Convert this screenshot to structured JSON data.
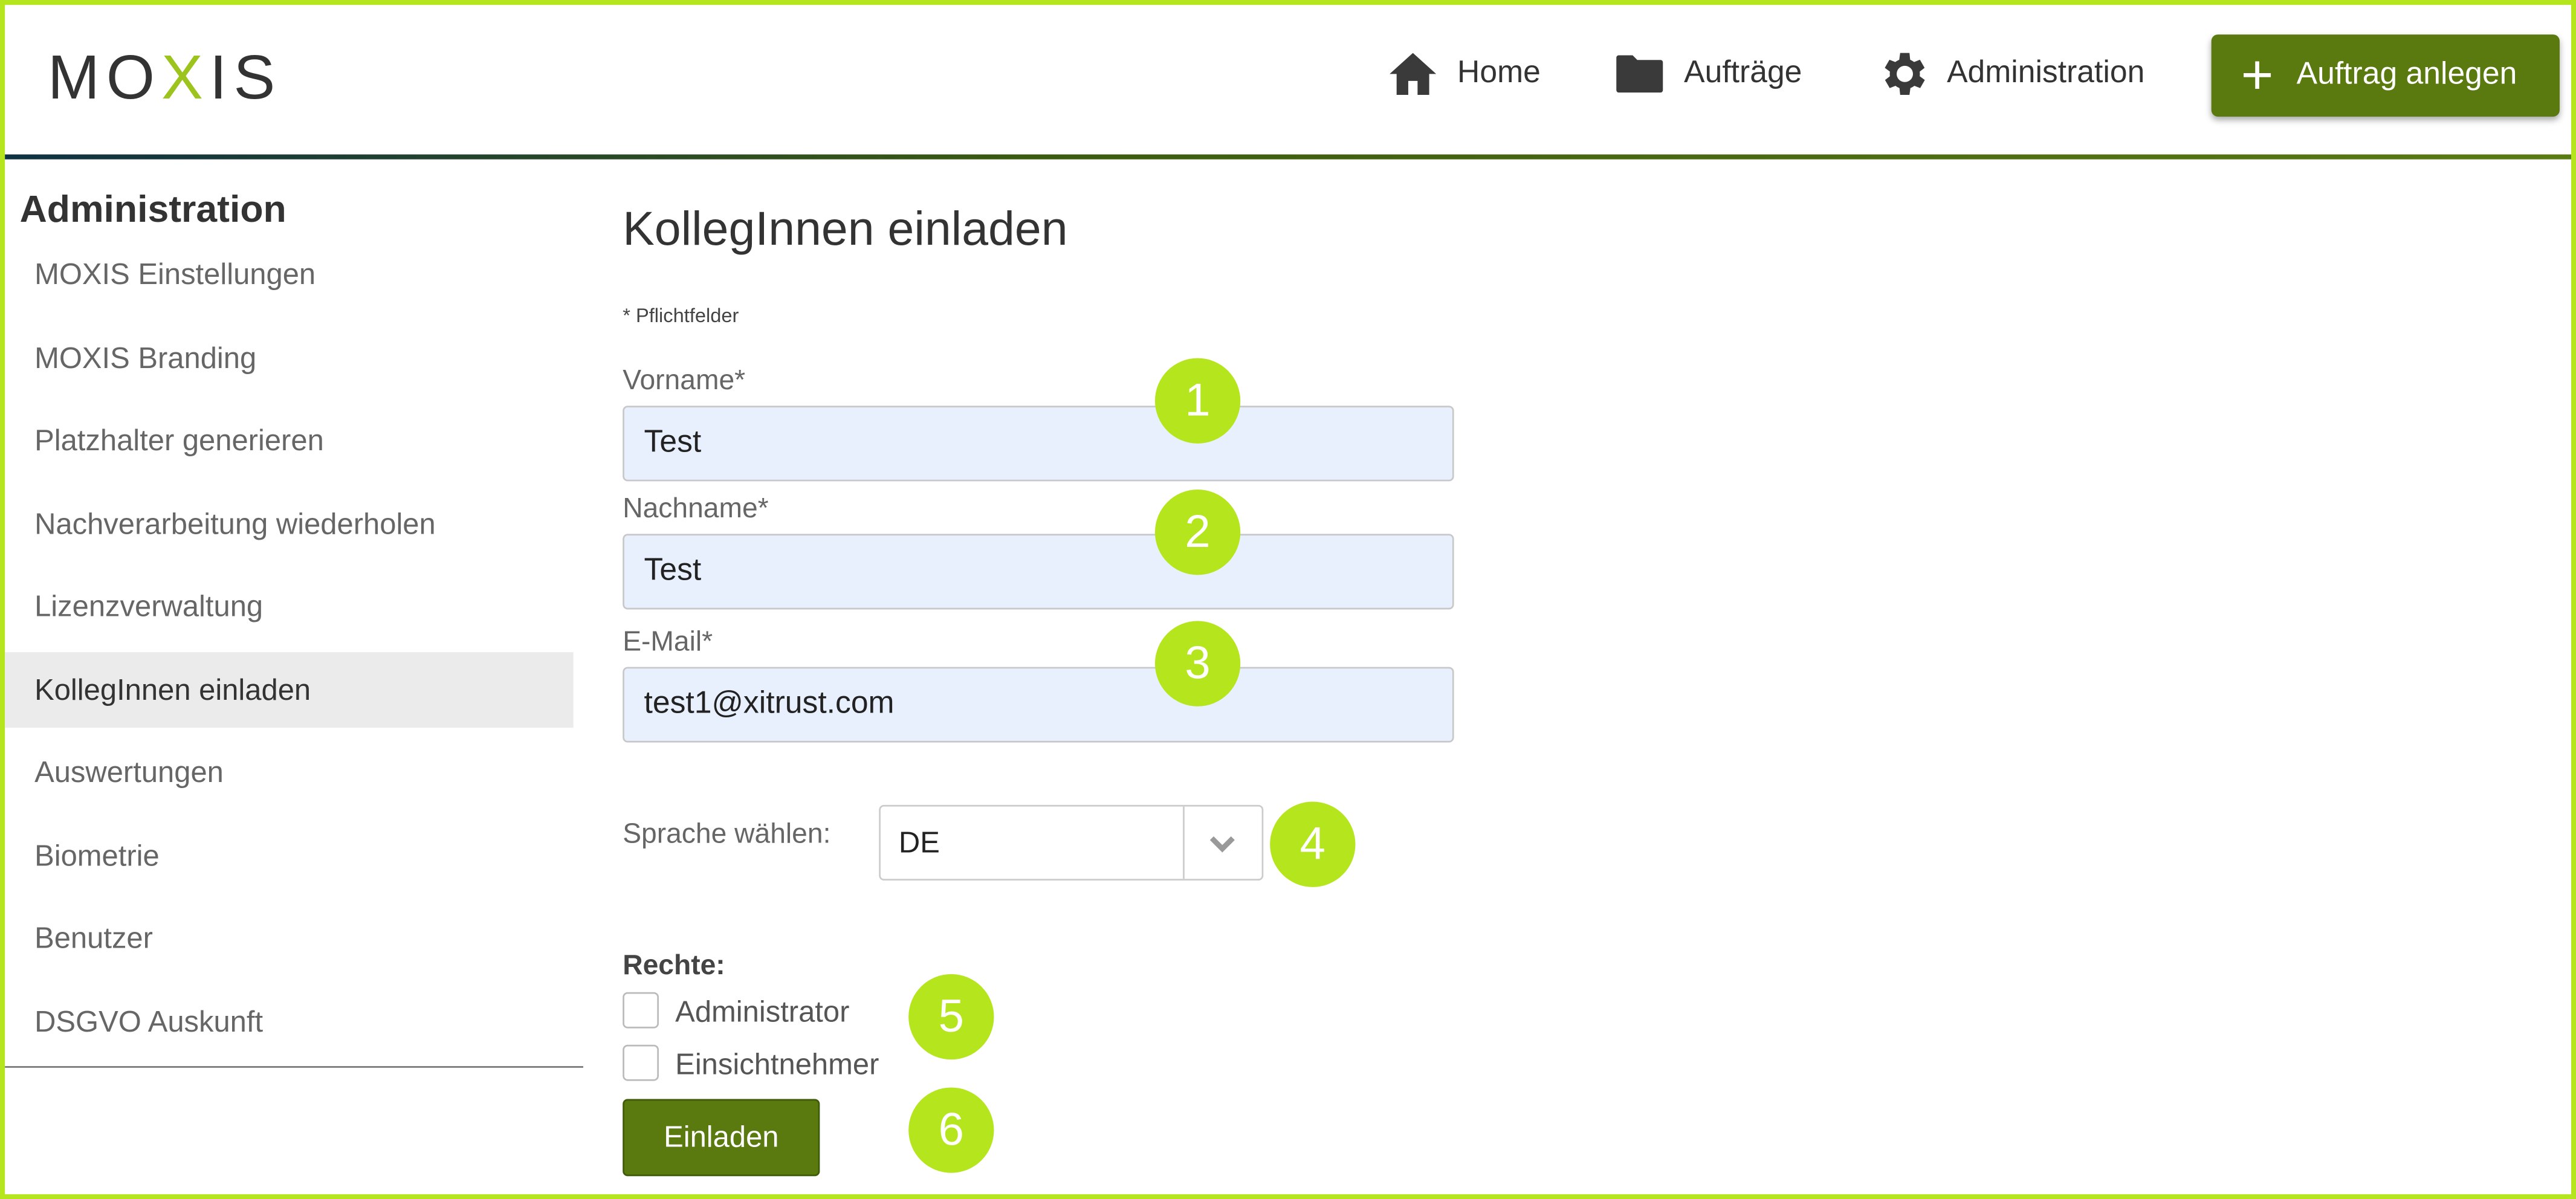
{
  "brand": {
    "logo_text": "MOXIS",
    "accent": "#b5e61d",
    "primary": "#5a7a10"
  },
  "nav": {
    "home": "Home",
    "orders": "Aufträge",
    "admin": "Administration",
    "create": "Auftrag anlegen"
  },
  "sidebar": {
    "title": "Administration",
    "items": [
      {
        "label": "MOXIS Einstellungen"
      },
      {
        "label": "MOXIS Branding"
      },
      {
        "label": "Platzhalter generieren"
      },
      {
        "label": "Nachverarbeitung wiederholen"
      },
      {
        "label": "Lizenzverwaltung"
      },
      {
        "label": "KollegInnen einladen",
        "active": true
      },
      {
        "label": "Auswertungen"
      },
      {
        "label": "Biometrie"
      },
      {
        "label": "Benutzer"
      },
      {
        "label": "DSGVO Auskunft"
      }
    ]
  },
  "form": {
    "title": "KollegInnen einladen",
    "required_note": "* Pflichtfelder",
    "firstname": {
      "label": "Vorname*",
      "value": "Test"
    },
    "lastname": {
      "label": "Nachname*",
      "value": "Test"
    },
    "email": {
      "label": "E-Mail*",
      "value": "test1@xitrust.com"
    },
    "language": {
      "label": "Sprache wählen:",
      "value": "DE"
    },
    "rights": {
      "label": "Rechte:",
      "admin": "Administrator",
      "viewer": "Einsichtnehmer",
      "admin_checked": false,
      "viewer_checked": false
    },
    "submit": "Einladen"
  },
  "badges": [
    "1",
    "2",
    "3",
    "4",
    "5",
    "6"
  ]
}
